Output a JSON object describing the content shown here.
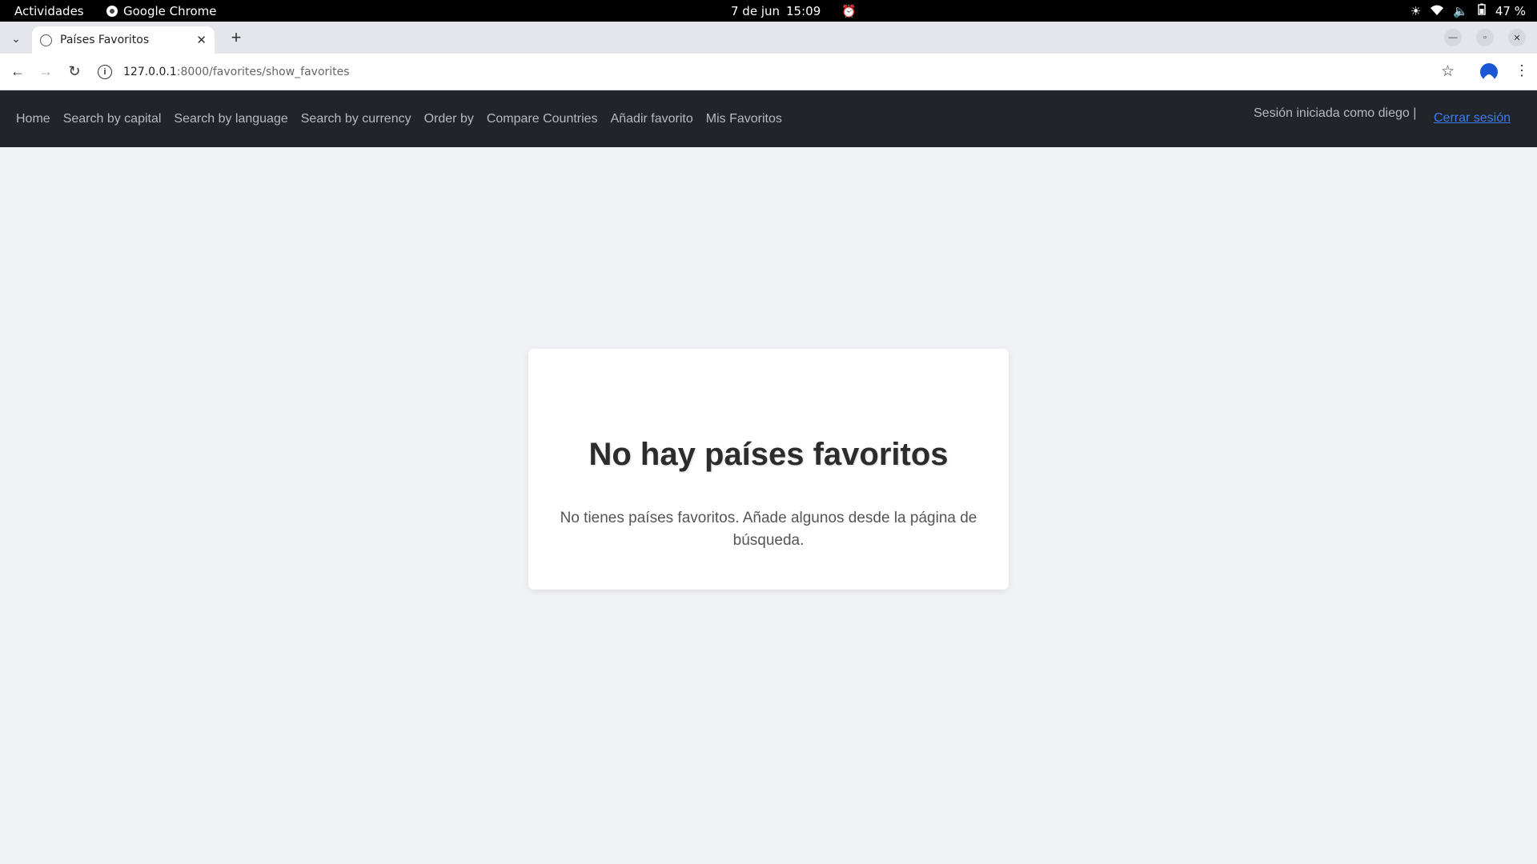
{
  "os": {
    "activities": "Actividades",
    "app_name": "Google Chrome",
    "date": "7 de jun",
    "time": "15:09",
    "battery": "47 %"
  },
  "browser": {
    "tab_title": "Países Favoritos",
    "url_host": "127.0.0.1",
    "url_rest": ":8000/favorites/show_favorites"
  },
  "nav": {
    "links": [
      "Home",
      "Search by capital",
      "Search by language",
      "Search by currency",
      "Order by",
      "Compare Countries",
      "Añadir favorito",
      "Mis Favoritos"
    ],
    "session_text": "Sesión iniciada como diego |",
    "logout_label": "Cerrar sesión",
    "logout_color": "#3b7bf2"
  },
  "card": {
    "title": "No hay países favoritos",
    "message": "No tienes países favoritos. Añade algunos desde la página de búsqueda."
  }
}
